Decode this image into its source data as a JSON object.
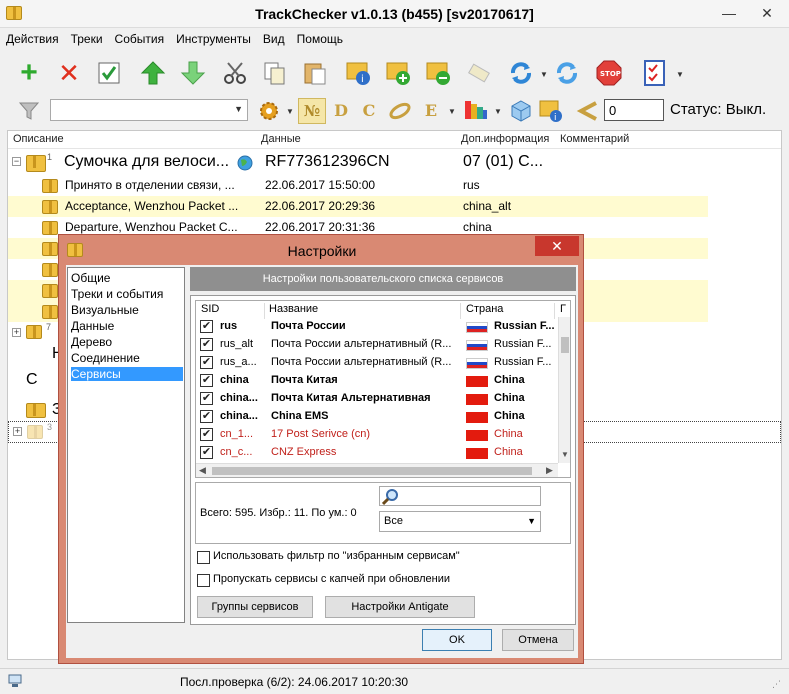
{
  "window": {
    "title": "TrackChecker v1.0.13 (b455)  [sv20170617]",
    "minimize": "—",
    "close": "✕"
  },
  "menu": [
    "Действия",
    "Треки",
    "События",
    "Инструменты",
    "Вид",
    "Помощь"
  ],
  "toolbar": {
    "icons": [
      "add-icon",
      "delete-icon",
      "check-icon",
      "up-icon",
      "down-icon",
      "cut-icon",
      "copy-icon",
      "paste-icon",
      "info-icon",
      "add-package-icon",
      "remove-package-icon",
      "erase-icon",
      "refresh-icon",
      "refresh-all-icon",
      "stop-icon",
      "checklist-icon"
    ],
    "stop_label": "STOP",
    "number_value": "0",
    "status": "Статус: Выкл.",
    "filter_letters": [
      "№",
      "D",
      "C",
      "E"
    ]
  },
  "list": {
    "columns": [
      "Описание",
      "Данные",
      "Доп.информация",
      "Комментарий"
    ],
    "group": {
      "count": "1",
      "description": "Сумочка для велоси...",
      "data": "RF773612396CN",
      "info": "07 (01) С..."
    },
    "rows": [
      {
        "description": "Принято в отделении связи, ...",
        "data": "22.06.2017 15:50:00",
        "info": "rus"
      },
      {
        "description": "Acceptance, Wenzhou Packet ...",
        "data": "22.06.2017 20:29:36",
        "info": "china_alt"
      },
      {
        "description": "Departure, Wenzhou Packet C...",
        "data": "22.06.2017 20:31:36",
        "info": "china"
      }
    ],
    "partial_group": {
      "count": "7"
    },
    "partial_letters": [
      "Н",
      "С",
      "З"
    ],
    "partial_group_3": {
      "count": "3"
    }
  },
  "statusbar": {
    "text": "Посл.проверка (6/2): 24.06.2017 10:20:30"
  },
  "dialog": {
    "title": "Настройки",
    "close": "✕",
    "nav": [
      "Общие",
      "Треки и события",
      "Визуальные",
      "Данные",
      "Дерево",
      "Соединение",
      "Сервисы"
    ],
    "panel_title": "Настройки пользовательского списка сервисов",
    "grid_columns": [
      "SID",
      "Название",
      "Страна",
      "Г"
    ],
    "services": [
      {
        "sid": "rus",
        "name": "Почта России",
        "country": "Russian F...",
        "style": "bold",
        "flag": "ru"
      },
      {
        "sid": "rus_alt",
        "name": "Почта России альтернативный (R...",
        "country": "Russian F...",
        "style": "normal",
        "flag": "ru"
      },
      {
        "sid": "rus_a...",
        "name": "Почта России альтернативный (R...",
        "country": "Russian F...",
        "style": "normal",
        "flag": "ru"
      },
      {
        "sid": "china",
        "name": "Почта Китая",
        "country": "China",
        "style": "bold",
        "flag": "cn"
      },
      {
        "sid": "china...",
        "name": "Почта Китая Альтернативная",
        "country": "China",
        "style": "bold",
        "flag": "cn"
      },
      {
        "sid": "china...",
        "name": "China EMS",
        "country": "China",
        "style": "bold",
        "flag": "cn"
      },
      {
        "sid": "cn_1...",
        "name": "17 Post Serivce (cn)",
        "country": "China",
        "style": "red",
        "flag": "cn"
      },
      {
        "sid": "cn_c...",
        "name": "CNZ Express",
        "country": "China",
        "style": "red",
        "flag": "cn"
      }
    ],
    "check_mark": "✔",
    "totals": "Всего: 595. Избр.: 11. По ум.: 0",
    "filter_select": "Все",
    "option_favorites": "Использовать фильтр по \"избранным сервисам\"",
    "option_captcha": "Пропускать сервисы с капчей при обновлении",
    "btn_groups": "Группы сервисов",
    "btn_antigate": "Настройки Antigate",
    "btn_ok": "OK",
    "btn_cancel": "Отмена"
  }
}
